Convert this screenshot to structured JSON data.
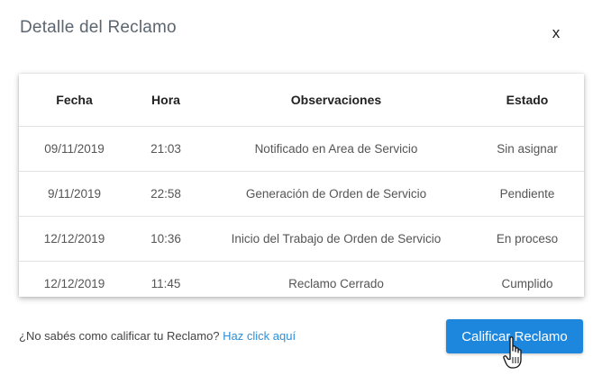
{
  "modal": {
    "title": "Detalle del Reclamo",
    "close_label": "x"
  },
  "table": {
    "headers": [
      "Fecha",
      "Hora",
      "Observaciones",
      "Estado"
    ],
    "rows": [
      {
        "fecha": "09/11/2019",
        "hora": "21:03",
        "observaciones": "Notificado en Area de Servicio",
        "estado": "Sin asignar"
      },
      {
        "fecha": "9/11/2019",
        "hora": "22:58",
        "observaciones": "Generación de Orden de Servicio",
        "estado": "Pendiente"
      },
      {
        "fecha": "12/12/2019",
        "hora": "10:36",
        "observaciones": "Inicio del Trabajo de Orden de Servicio",
        "estado": "En proceso"
      },
      {
        "fecha": "12/12/2019",
        "hora": "11:45",
        "observaciones": "Reclamo Cerrado",
        "estado": "Cumplido"
      }
    ]
  },
  "footer": {
    "help_text": "¿No sabés como calificar tu Reclamo?",
    "help_link": "Haz click aquí",
    "rate_button": "Calificar Reclamo"
  },
  "colors": {
    "accent": "#1d86dd",
    "link": "#2f8fd8",
    "title": "#5b6670"
  },
  "icons": {
    "cursor": "hand-pointer-icon"
  }
}
